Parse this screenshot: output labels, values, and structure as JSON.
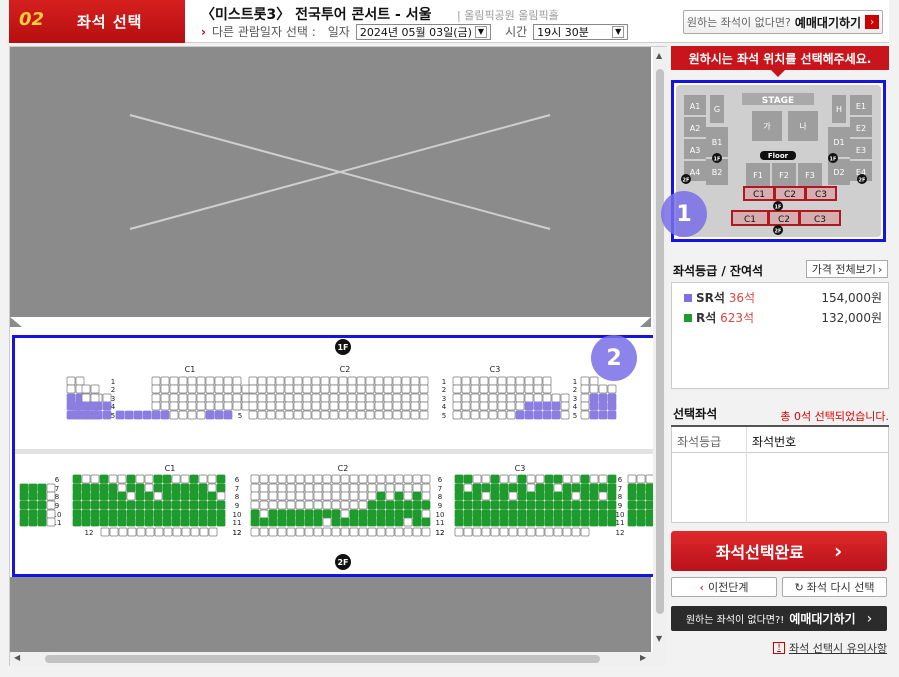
{
  "header": {
    "step_num": "02",
    "step_label": "좌석 선택",
    "title": "〈미스트롯3〉 전국투어 콘서트 - 서울",
    "venue": "| 올림픽공원 올림픽홀",
    "other_date_label": "다른 관람일자 선택 :",
    "date_label": "일자",
    "date_value": "2024년 05월 03일(금)",
    "time_label": "시간",
    "time_value": "19시 30분",
    "wait_prefix": "원하는 좌석이 없다면?",
    "wait_label": "예매대기하기"
  },
  "annotations": {
    "badge1": "1",
    "badge2": "2"
  },
  "seatmap": {
    "floor1": "1F",
    "floor2": "2F",
    "sections_top": [
      "C1",
      "C2",
      "C3"
    ],
    "sections_bottom": [
      "C1",
      "C2",
      "C3"
    ],
    "rows_top": [
      "1",
      "2",
      "3",
      "4",
      "5"
    ],
    "rows_bottom": [
      "6",
      "7",
      "8",
      "9",
      "10",
      "11",
      "12"
    ],
    "colors": {
      "sr": "#8c7ee0",
      "r": "#1f9a2c",
      "empty": "#ffffff"
    }
  },
  "sidebar": {
    "header": "원하시는 좌석 위치를 선택해주세요.",
    "minimap": {
      "stage": "STAGE",
      "floor": "Floor",
      "blocks_left": [
        "A1",
        "A2",
        "A3",
        "A4"
      ],
      "blocks_right": [
        "E1",
        "E2",
        "E3",
        "E4"
      ],
      "inner": [
        "G",
        "가",
        "나",
        "H",
        "B1",
        "B2",
        "D1",
        "D2",
        "F1",
        "F2",
        "F3"
      ],
      "upper": [
        "C1",
        "C2",
        "C3"
      ],
      "lower": [
        "C1",
        "C2",
        "C3"
      ],
      "floor_tags": [
        "1F",
        "1F",
        "2F",
        "2F",
        "1F",
        "2F"
      ]
    },
    "grade_title": "좌석등급 / 잔여석",
    "price_all": "가격 전체보기",
    "grades": [
      {
        "name": "SR석",
        "count": "36석",
        "price": "154,000원",
        "color": "#7f6fe0"
      },
      {
        "name": "R석",
        "count": "623석",
        "price": "132,000원",
        "color": "#1f9a2c"
      }
    ],
    "selected_title": "선택좌석",
    "selected_count": "총 0석 선택되었습니다.",
    "col_grade": "좌석등급",
    "col_seat": "좌석번호",
    "done": "좌석선택완료",
    "prev": "이전단계",
    "reselect": "좌석 다시 선택",
    "wait_prefix": "원하는 좌석이 없다면?!",
    "wait_label": "예매대기하기",
    "notice": "좌석 선택시 유의사항"
  }
}
